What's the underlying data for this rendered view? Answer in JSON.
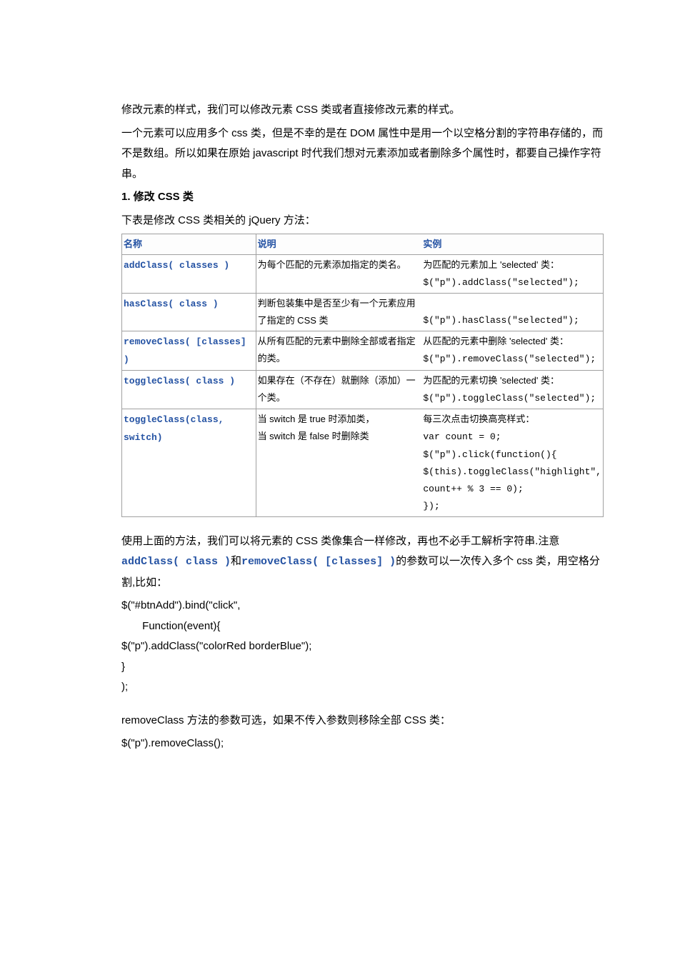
{
  "intro": {
    "p1": "修改元素的样式，我们可以修改元素 CSS 类或者直接修改元素的样式。",
    "p2": "一个元素可以应用多个 css 类，但是不幸的是在 DOM 属性中是用一个以空格分割的字符串存储的，而不是数组。所以如果在原始 javascript 时代我们想对元素添加或者删除多个属性时，都要自己操作字符串。"
  },
  "section1": {
    "heading": "1. 修改 CSS 类",
    "lead": "下表是修改 CSS 类相关的 jQuery 方法："
  },
  "table": {
    "head": {
      "c1": "名称",
      "c2": "说明",
      "c3": "实例"
    },
    "rows": [
      {
        "name": "addClass( classes )",
        "desc": "为每个匹配的元素添加指定的类名。",
        "ex_desc": "为匹配的元素加上 'selected' 类：",
        "ex_code": "$(\"p\").addClass(\"selected\");"
      },
      {
        "name": "hasClass( class )",
        "desc": "判断包装集中是否至少有一个元素应用了指定的 CSS 类",
        "ex_desc": "",
        "ex_code": "$(\"p\").hasClass(\"selected\");"
      },
      {
        "name": "removeClass( [classes] )",
        "desc": "从所有匹配的元素中删除全部或者指定的类。",
        "ex_desc": "从匹配的元素中删除 'selected' 类：",
        "ex_code": "$(\"p\").removeClass(\"selected\");"
      },
      {
        "name": "toggleClass( class )",
        "desc": "如果存在（不存在）就删除（添加）一个类。",
        "ex_desc": "为匹配的元素切换 'selected' 类：",
        "ex_code": "$(\"p\").toggleClass(\"selected\");"
      },
      {
        "name": "toggleClass(class, switch)",
        "desc_l1": "当 switch 是 true 时添加类，",
        "desc_l2": "当 switch 是 false 时删除类",
        "ex_l1": "每三次点击切换高亮样式：",
        "ex_l2": "var count = 0;",
        "ex_l3": "$(\"p\").click(function(){",
        "ex_l4": "  $(this).toggleClass(\"highlight\",",
        "ex_l5": "count++ % 3 == 0);",
        "ex_l6": "});"
      }
    ]
  },
  "aftertable": {
    "p1a": "使用上面的方法，我们可以将元素的 CSS 类像集合一样修改，再也不必手工解析字符串.注意 ",
    "m1": "addClass( class )",
    "mid": "和",
    "m2": "removeClass( [classes] )",
    "p1b": "的参数可以一次传入多个 css 类，用空格分割,比如：",
    "code": "$(\"#btnAdd\").bind(\"click\",\n       Function(event){\n$(\"p\").addClass(\"colorRed borderBlue\");\n}\n);",
    "p2": "removeClass 方法的参数可选，如果不传入参数则移除全部 CSS 类：",
    "code2": "$(\"p\").removeClass();"
  }
}
